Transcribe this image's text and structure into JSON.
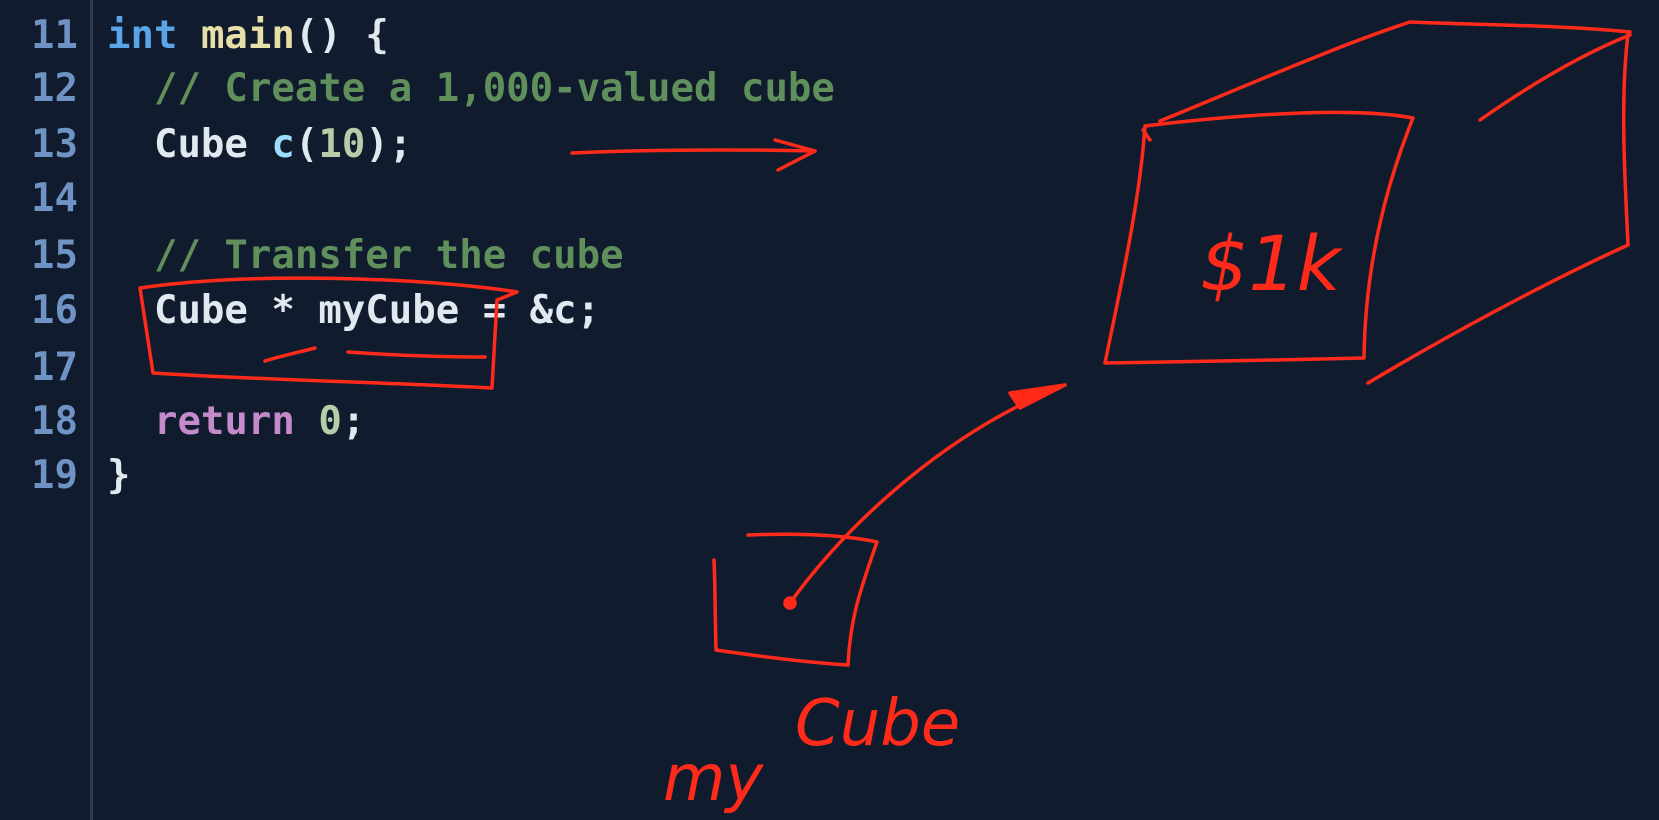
{
  "colors": {
    "background": "#101c2e",
    "line_number": "#6f93c5",
    "keyword": "#5aa5e8",
    "function": "#e6e0a6",
    "comment": "#5f8f5a",
    "variable": "#9cdcfe",
    "number": "#b5cea8",
    "return_keyword": "#c58ac9",
    "annotation_ink": "#ff2a1a"
  },
  "code_lines": [
    {
      "number": "11",
      "tokens": [
        {
          "cls": "tok-keyword",
          "text": "int"
        },
        {
          "cls": "tok-punct",
          "text": " "
        },
        {
          "cls": "tok-func",
          "text": "main"
        },
        {
          "cls": "tok-punct",
          "text": "() {"
        }
      ]
    },
    {
      "number": "12",
      "tokens": [
        {
          "cls": "tok-punct",
          "text": "  "
        },
        {
          "cls": "tok-comment",
          "text": "// Create a 1,000-valued cube"
        }
      ]
    },
    {
      "number": "13",
      "tokens": [
        {
          "cls": "tok-punct",
          "text": "  "
        },
        {
          "cls": "tok-type",
          "text": "Cube"
        },
        {
          "cls": "tok-punct",
          "text": " "
        },
        {
          "cls": "tok-var",
          "text": "c"
        },
        {
          "cls": "tok-punct",
          "text": "("
        },
        {
          "cls": "tok-num",
          "text": "10"
        },
        {
          "cls": "tok-punct",
          "text": ");"
        }
      ]
    },
    {
      "number": "14",
      "tokens": []
    },
    {
      "number": "15",
      "tokens": [
        {
          "cls": "tok-punct",
          "text": "  "
        },
        {
          "cls": "tok-comment",
          "text": "// Transfer the cube"
        }
      ]
    },
    {
      "number": "16",
      "tokens": [
        {
          "cls": "tok-punct",
          "text": "  "
        },
        {
          "cls": "tok-type",
          "text": "Cube"
        },
        {
          "cls": "tok-punct",
          "text": " * "
        },
        {
          "cls": "tok-type",
          "text": "myCube"
        },
        {
          "cls": "tok-punct",
          "text": " = &c;"
        }
      ]
    },
    {
      "number": "17",
      "tokens": []
    },
    {
      "number": "18",
      "tokens": [
        {
          "cls": "tok-punct",
          "text": "  "
        },
        {
          "cls": "tok-return",
          "text": "return"
        },
        {
          "cls": "tok-punct",
          "text": " "
        },
        {
          "cls": "tok-num",
          "text": "0"
        },
        {
          "cls": "tok-punct",
          "text": ";"
        }
      ]
    },
    {
      "number": "19",
      "tokens": [
        {
          "cls": "tok-punct",
          "text": "}"
        }
      ]
    }
  ],
  "annotations": {
    "cube_value_label": "$1k",
    "pointer_label_my": "my",
    "pointer_label_cube": "Cube"
  }
}
